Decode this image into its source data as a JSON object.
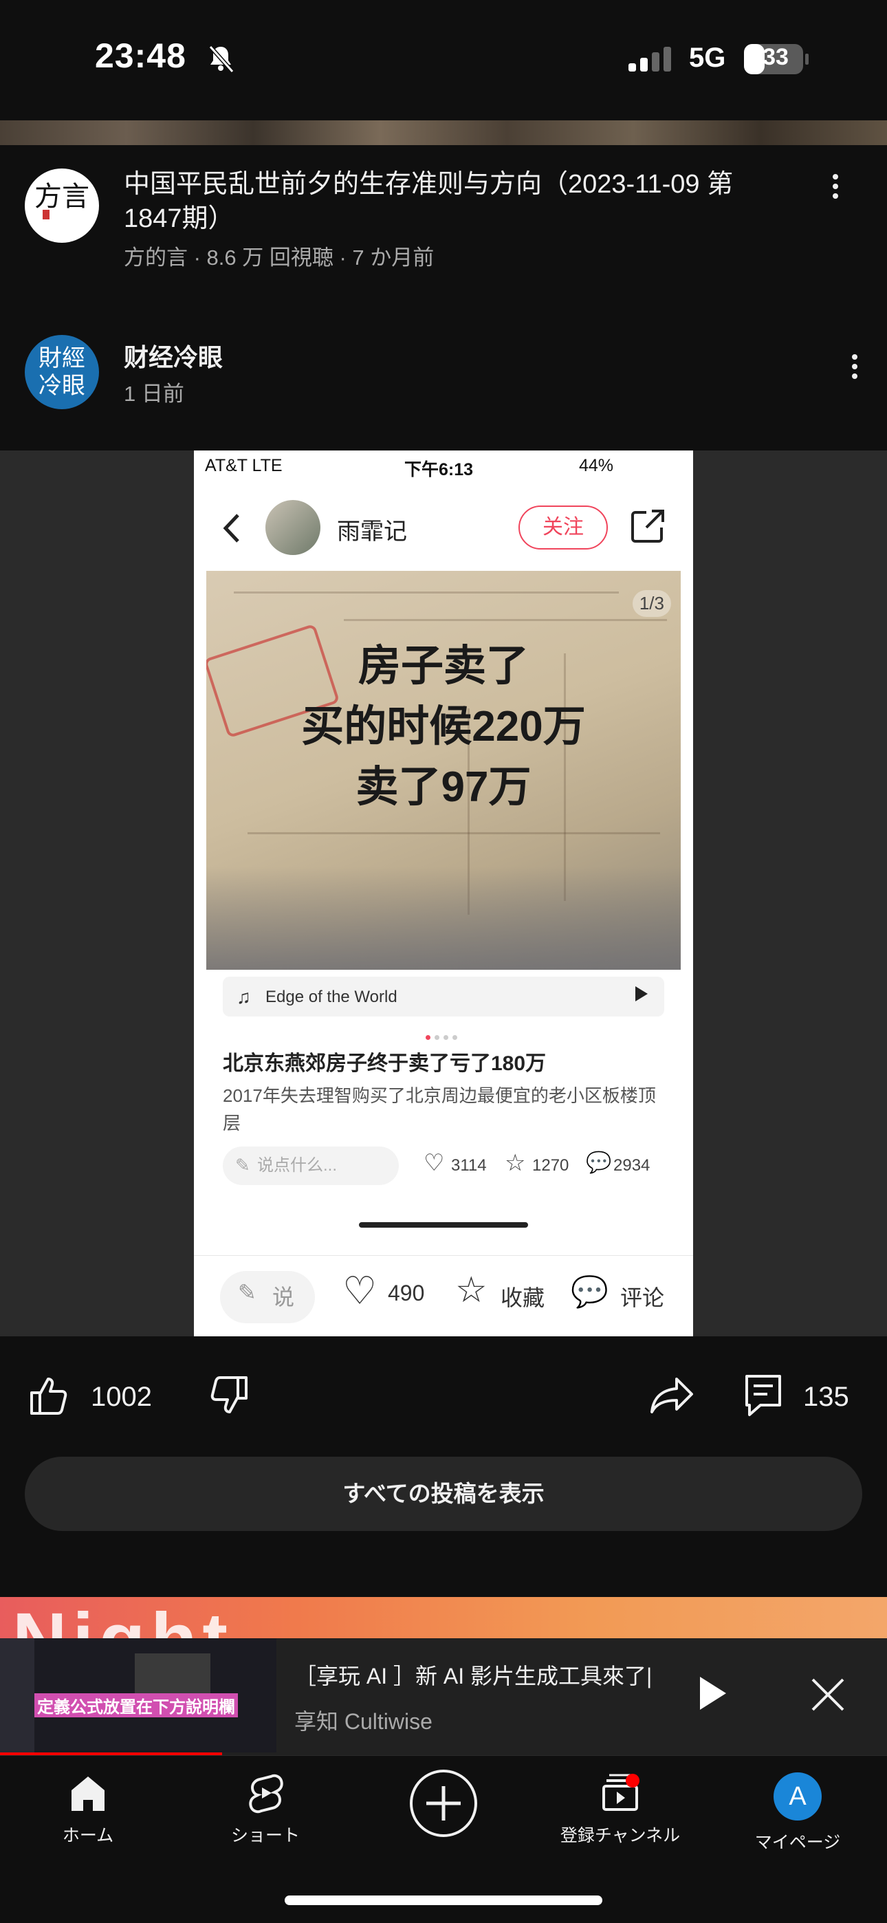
{
  "status_bar": {
    "time": "23:48",
    "network": "5G",
    "battery": "33"
  },
  "video": {
    "title": "中国平民乱世前夕的生存准则与方向（2023-11-09 第1847期）",
    "channel": "方的言",
    "meta": "方的言 · 8.6 万 回視聴 · 7 か月前",
    "avatar_text": "方言"
  },
  "post": {
    "channel_name": "财经冷眼",
    "avatar_text": "財經冷眼",
    "time": "1 日前"
  },
  "screenshot": {
    "status_left": "AT&T  LTE",
    "status_center": "下午6:13",
    "status_right": "44%",
    "username": "雨霏记",
    "follow_label": "关注",
    "photo_counter": "1/3",
    "headline_lines": [
      "房子卖了",
      "买的时候220万",
      "卖了97万"
    ],
    "music": "Edge of the World",
    "title": "北京东燕郊房子终于卖了亏了180万",
    "desc": "2017年失去理智购买了北京周边最便宜的老小区板楼顶层",
    "say_placeholder": "说点什么...",
    "likes": "3114",
    "stars": "1270",
    "comments": "2934",
    "bottom_say": "说",
    "bottom_likes": "490",
    "bottom_fav": "收藏",
    "bottom_comment": "评论"
  },
  "actions": {
    "likes": "1002",
    "comments": "135"
  },
  "all_posts_label": "すべての投稿を表示",
  "banner_text": "Night",
  "mini_player": {
    "title": "［享玩 AI ］新 AI 影片生成工具來了|...",
    "channel": "享知 Cultiwise",
    "thumb_caption": "定義公式放置在下方說明欄",
    "progress": 0.25
  },
  "nav": {
    "home": "ホーム",
    "shorts": "ショート",
    "subscriptions": "登録チャンネル",
    "you": "マイページ",
    "avatar_letter": "A"
  }
}
